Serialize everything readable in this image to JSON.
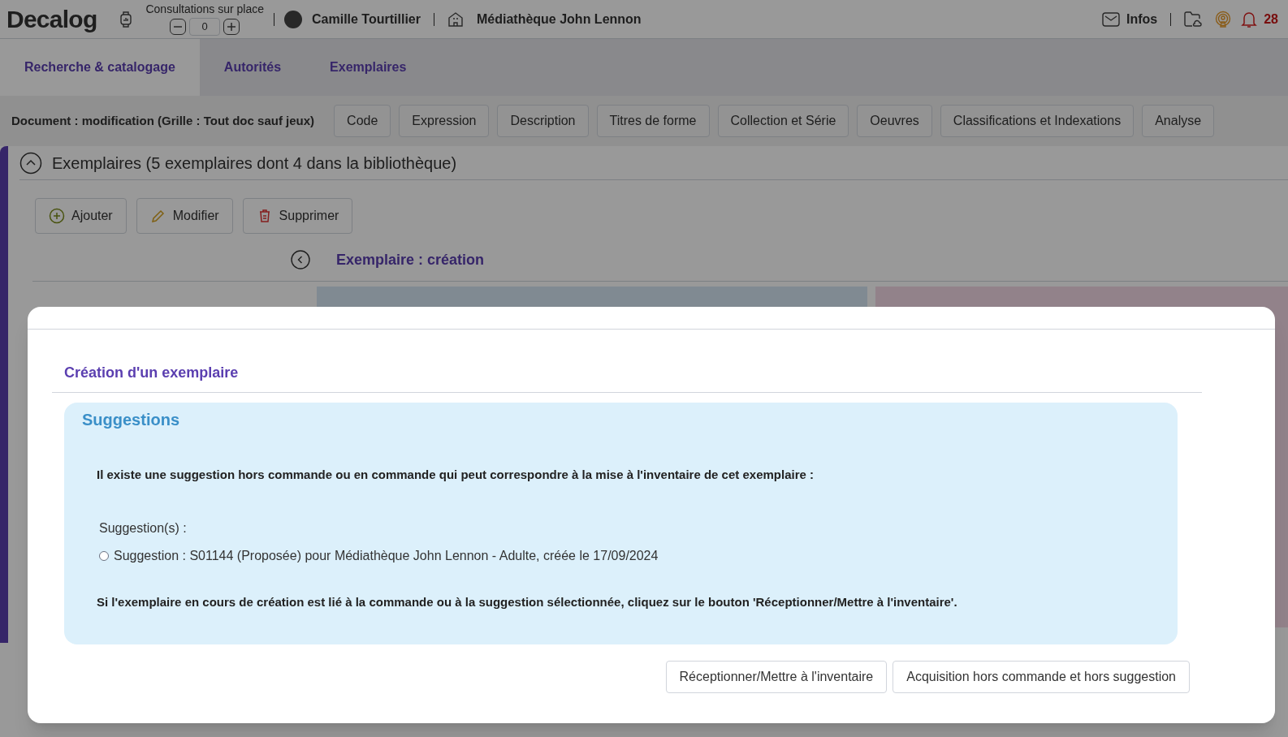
{
  "header": {
    "logo": "Decalog",
    "consultations_label": "Consultations sur place",
    "counter_value": "0",
    "user": "Camille Tourtillier",
    "library": "Médiathèque John Lennon",
    "infos": "Infos",
    "notification_count": "28"
  },
  "nav_tabs": [
    {
      "label": "Recherche & catalogage",
      "selected": true
    },
    {
      "label": "Autorités",
      "selected": false
    },
    {
      "label": "Exemplaires",
      "selected": false
    }
  ],
  "toolbar": {
    "document_title": "Document : modification (Grille : Tout doc sauf jeux)",
    "buttons": [
      "Code",
      "Expression",
      "Description",
      "Titres de forme",
      "Collection et Série",
      "Oeuvres",
      "Classifications et Indexations",
      "Analyse"
    ]
  },
  "section": {
    "title": "Exemplaires (5 exemplaires dont 4 dans la bibliothèque)",
    "expanded": true,
    "actions": [
      {
        "kind": "add",
        "label": "Ajouter"
      },
      {
        "kind": "edit",
        "label": "Modifier"
      },
      {
        "kind": "delete",
        "label": "Supprimer"
      }
    ],
    "subtitle": "Exemplaire : création"
  },
  "modal": {
    "title": "Création d'un exemplaire",
    "suggestions": {
      "heading": "Suggestions",
      "intro": "Il existe une suggestion hors commande ou en commande qui peut correspondre à la mise à l'inventaire de cet exemplaire :",
      "list_label": "Suggestion(s) :",
      "options": [
        {
          "label": "Suggestion : S01144 (Proposée) pour Médiathèque John Lennon - Adulte, créée le 17/09/2024",
          "selected": false
        }
      ],
      "note": "Si l'exemplaire en cours de création est lié à la commande ou à la suggestion sélectionnée, cliquez sur le bouton 'Réceptionner/Mettre à l'inventaire'."
    },
    "buttons": [
      "Réceptionner/Mettre à l'inventaire",
      "Acquisition hors commande et hors suggestion"
    ]
  }
}
